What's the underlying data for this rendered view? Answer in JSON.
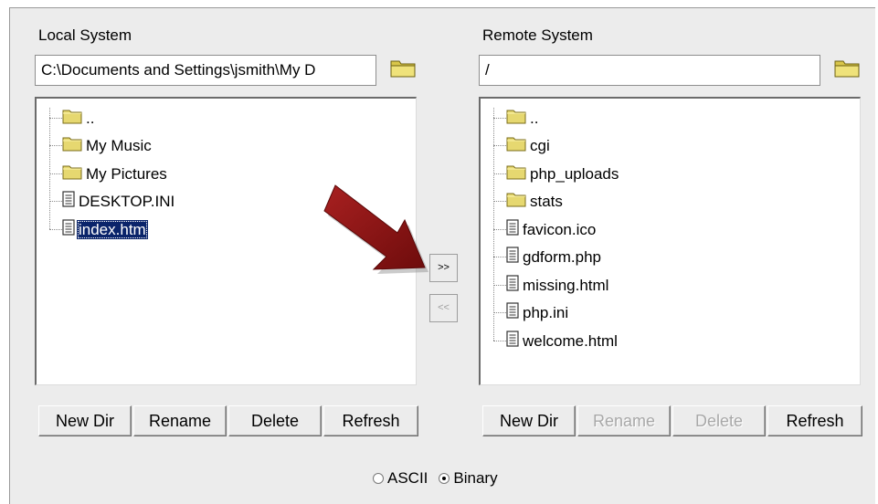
{
  "local": {
    "title": "Local System",
    "path": "C:\\Documents and Settings\\jsmith\\My D",
    "items": [
      {
        "label": "..",
        "type": "folder",
        "selected": false
      },
      {
        "label": "My Music",
        "type": "folder",
        "selected": false
      },
      {
        "label": "My Pictures",
        "type": "folder",
        "selected": false
      },
      {
        "label": "DESKTOP.INI",
        "type": "file",
        "selected": false
      },
      {
        "label": "index.htm",
        "type": "file",
        "selected": true
      }
    ],
    "buttons": {
      "new_dir": "New Dir",
      "rename": "Rename",
      "delete": "Delete",
      "refresh": "Refresh"
    }
  },
  "remote": {
    "title": "Remote System",
    "path": "/",
    "items": [
      {
        "label": "..",
        "type": "folder"
      },
      {
        "label": "cgi",
        "type": "folder"
      },
      {
        "label": "php_uploads",
        "type": "folder"
      },
      {
        "label": "stats",
        "type": "folder"
      },
      {
        "label": "favicon.ico",
        "type": "file"
      },
      {
        "label": "gdform.php",
        "type": "file"
      },
      {
        "label": "missing.html",
        "type": "file"
      },
      {
        "label": "php.ini",
        "type": "file"
      },
      {
        "label": "welcome.html",
        "type": "file"
      }
    ],
    "buttons": {
      "new_dir": "New Dir",
      "rename": "Rename",
      "delete": "Delete",
      "refresh": "Refresh"
    }
  },
  "transfer": {
    "upload": ">>",
    "download": "<<"
  },
  "mode": {
    "ascii": "ASCII",
    "binary": "Binary",
    "selected": "binary"
  },
  "icons": {
    "folder": "folder-icon",
    "file": "file-icon",
    "browse": "open-folder-icon",
    "annotation": "red-arrow-icon"
  },
  "colors": {
    "panel": "#ececec",
    "selection": "#0a246a",
    "folder": "#e6d870",
    "arrow": "#8b1010"
  }
}
